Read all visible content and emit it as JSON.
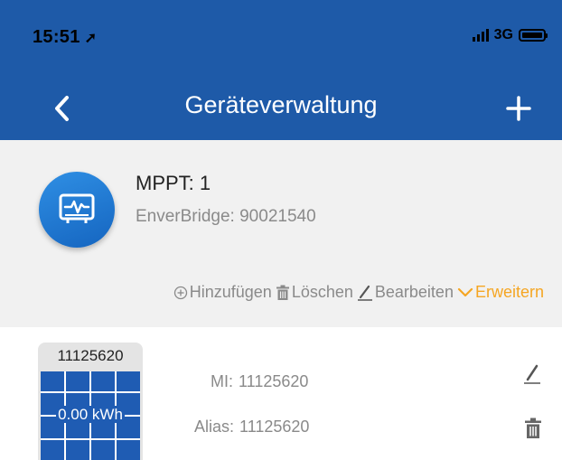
{
  "status_bar": {
    "time": "15:51",
    "network": "3G"
  },
  "nav": {
    "title": "Geräteverwaltung"
  },
  "device": {
    "mppt": "MPPT: 1",
    "bridge": "EnverBridge: 90021540",
    "actions": {
      "add": "Hinzufügen",
      "delete": "Löschen",
      "edit": "Bearbeiten",
      "expand": "Erweitern"
    }
  },
  "microinverter": {
    "serial": "11125620",
    "energy": "0.00 kWh",
    "mi_label": "MI:",
    "mi_value": "11125620",
    "alias_label": "Alias:",
    "alias_value": "11125620"
  },
  "colors": {
    "header": "#1e5aa8",
    "accent": "#f5a623",
    "panel": "#1f5cb3"
  }
}
